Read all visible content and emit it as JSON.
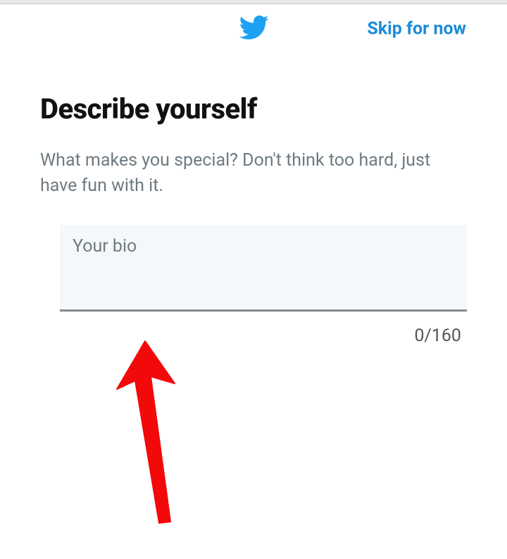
{
  "header": {
    "skip_label": "Skip for now"
  },
  "page": {
    "title": "Describe yourself",
    "subtitle": "What makes you special? Don't think too hard, just have fun with it."
  },
  "bio": {
    "placeholder": "Your bio",
    "value": "",
    "counter": "0/160",
    "max": 160
  },
  "colors": {
    "brand": "#1da1f2",
    "link": "#1a8cd8",
    "muted": "#6e7a82",
    "annotation": "#f20a0a"
  }
}
